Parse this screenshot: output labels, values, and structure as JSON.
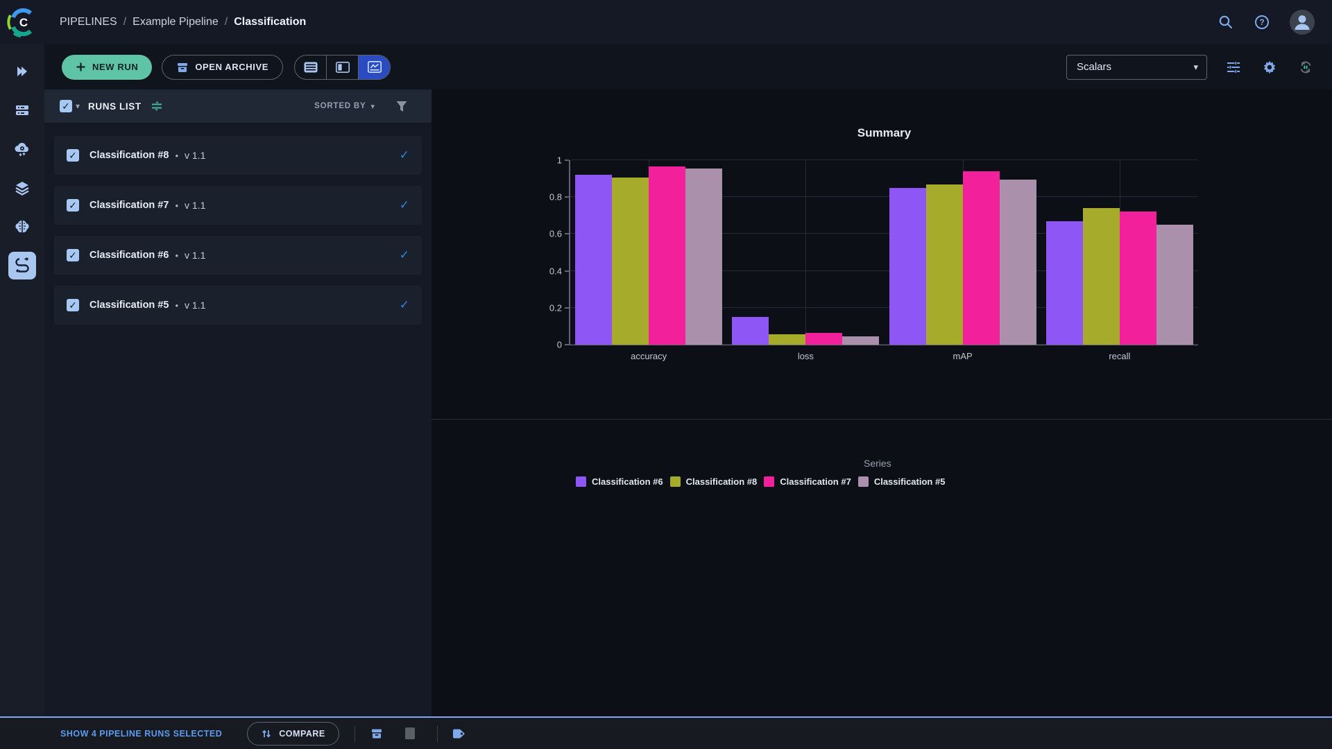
{
  "header": {
    "breadcrumb": [
      "PIPELINES",
      "Example Pipeline",
      "Classification"
    ],
    "separator": "/",
    "icons": [
      "search-icon",
      "help-icon",
      "avatar"
    ]
  },
  "sidebar": {
    "items": [
      {
        "icon": "projects-icon",
        "active": false
      },
      {
        "icon": "queues-icon",
        "active": false
      },
      {
        "icon": "workers-icon",
        "active": false
      },
      {
        "icon": "datasets-icon",
        "active": false
      },
      {
        "icon": "models-icon",
        "active": false
      },
      {
        "icon": "pipelines-icon",
        "active": true
      }
    ]
  },
  "toolbar": {
    "new_run_label": "NEW RUN",
    "open_archive_label": "OPEN ARCHIVE",
    "view_modes": [
      "table-view",
      "split-view",
      "chart-view"
    ],
    "active_view_mode": "chart-view",
    "metric_select_value": "Scalars",
    "right_icons": [
      "tune-icon",
      "gear-icon",
      "auto-refresh-icon"
    ]
  },
  "runs_panel": {
    "title": "RUNS LIST",
    "sorted_by_label": "SORTED BY",
    "select_all_checked": true,
    "runs": [
      {
        "name": "Classification #8",
        "bullet": "•",
        "version": "v 1.1",
        "checked": true,
        "status_check": "✓"
      },
      {
        "name": "Classification #7",
        "bullet": "•",
        "version": "v 1.1",
        "checked": true,
        "status_check": "✓"
      },
      {
        "name": "Classification #6",
        "bullet": "•",
        "version": "v 1.1",
        "checked": true,
        "status_check": "✓"
      },
      {
        "name": "Classification #5",
        "bullet": "•",
        "version": "v 1.1",
        "checked": true,
        "status_check": "✓"
      }
    ]
  },
  "chart_data": {
    "type": "bar",
    "title": "Summary",
    "categories": [
      "accuracy",
      "loss",
      "mAP",
      "recall"
    ],
    "series": [
      {
        "name": "Classification #6",
        "color": "#8e57f5",
        "values": [
          0.92,
          0.15,
          0.85,
          0.67
        ]
      },
      {
        "name": "Classification #8",
        "color": "#a6ab2b",
        "values": [
          0.905,
          0.055,
          0.87,
          0.74
        ]
      },
      {
        "name": "Classification #7",
        "color": "#f2209a",
        "values": [
          0.965,
          0.065,
          0.94,
          0.72
        ]
      },
      {
        "name": "Classification #5",
        "color": "#ab90ab",
        "values": [
          0.955,
          0.045,
          0.895,
          0.65
        ]
      }
    ],
    "legend_title": "Series",
    "legend_position": "bottom",
    "ylim": [
      0,
      1
    ],
    "yticks": [
      0,
      0.2,
      0.4,
      0.6,
      0.8,
      1
    ],
    "grid": true
  },
  "footer": {
    "selection_text": "SHOW 4 PIPELINE RUNS SELECTED",
    "compare_label": "COMPARE",
    "icons": [
      "archive-icon",
      "square-icon",
      "tag-icon"
    ]
  },
  "colors": {
    "accent_green": "#5fc3a6",
    "accent_blue": "#7fa9ea",
    "active_toggle_blue": "#2b4cc1",
    "link_blue": "#5d9bf0",
    "checkbox_blue": "#a6c8f2",
    "check_blue": "#2e87e5",
    "teal_icon": "#49b8a0"
  }
}
